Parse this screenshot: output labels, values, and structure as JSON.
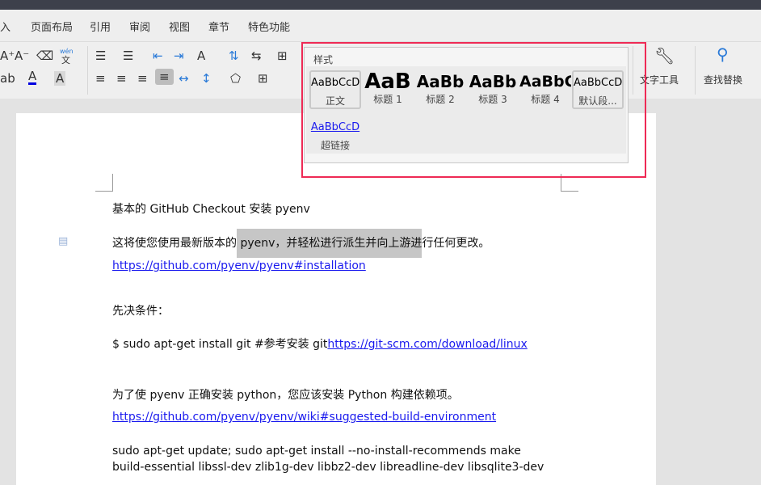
{
  "menu": [
    "入",
    "页面布局",
    "引用",
    "审阅",
    "视图",
    "章节",
    "特色功能"
  ],
  "styles_panel": {
    "title": "样式",
    "items": [
      {
        "preview": "AaBbCcD",
        "label": "正文"
      },
      {
        "preview": "AaB",
        "label": "标题 1"
      },
      {
        "preview": "AaBb",
        "label": "标题 2"
      },
      {
        "preview": "AaBb",
        "label": "标题 3"
      },
      {
        "preview": "AaBbC",
        "label": "标题 4"
      },
      {
        "preview": "AaBbCcD",
        "label": "默认段..."
      }
    ],
    "hyperlink": {
      "preview": "AaBbCcD",
      "label": "超链接"
    }
  },
  "tools": {
    "text_tools": "文字工具",
    "find_replace": "查找替换",
    "pinyin": "wén",
    "pinyin2": "文"
  },
  "document": {
    "line1": "基本的 GitHub Checkout   安装 pyenv",
    "line2_pre": "这将使您使用最新版本的",
    "line2_hl": " pyenv，并轻松进行派生并向上游进",
    "line2_post": "行任何更改。",
    "link1": "https://github.com/pyenv/pyenv#installation",
    "prereq": "先决条件：",
    "cmd": "$ sudo apt-get install git   #参考安装 git",
    "link2": "https://git-scm.com/download/linux",
    "para": "为了使 pyenv 正确安装 python，您应该安装 Python 构建依赖项。",
    "link3": "https://github.com/pyenv/pyenv/wiki#suggested-build-environment",
    "cmd2": "sudo   apt-get   update;   sudo   apt-get   install   --no-install-recommends   make",
    "cmd3": "build-essential  libssl-dev  zlib1g-dev  libbz2-dev  libreadline-dev  libsqlite3-dev"
  },
  "colors": {
    "accent_red": "#ee2a55",
    "link": "#1a1aee",
    "highlight": "#c6c6c6"
  }
}
